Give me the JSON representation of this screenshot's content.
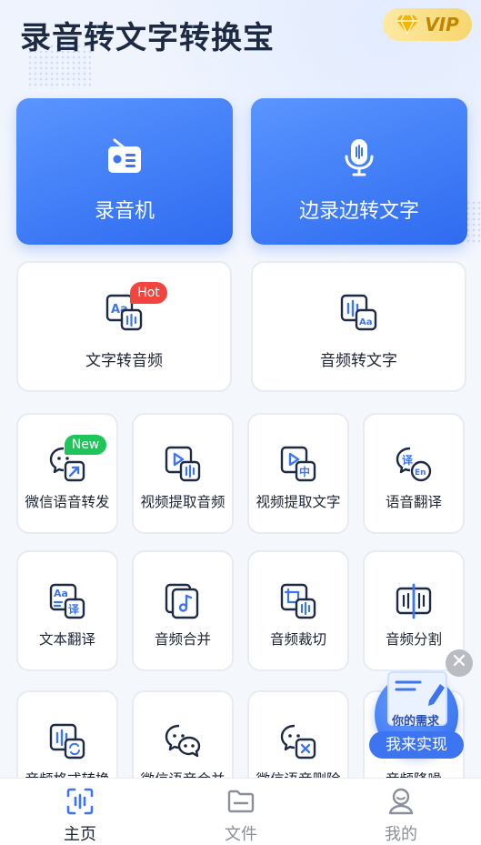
{
  "header": {
    "title": "录音转文字转换宝",
    "vip_label": "VIP"
  },
  "big_features": [
    {
      "label": "录音机",
      "icon": "radio-recorder-icon"
    },
    {
      "label": "边录边转文字",
      "icon": "microphone-icon"
    }
  ],
  "mid_features": [
    {
      "label": "文字转音频",
      "icon": "text-to-audio-icon",
      "badge": "Hot"
    },
    {
      "label": "音频转文字",
      "icon": "audio-to-text-icon"
    }
  ],
  "tools": [
    {
      "label": "微信语音转发",
      "icon": "wechat-forward-icon",
      "badge": "New"
    },
    {
      "label": "视频提取音频",
      "icon": "video-extract-audio-icon"
    },
    {
      "label": "视频提取文字",
      "icon": "video-extract-text-icon"
    },
    {
      "label": "语音翻译",
      "icon": "voice-translate-icon"
    },
    {
      "label": "文本翻译",
      "icon": "text-translate-icon"
    },
    {
      "label": "音频合并",
      "icon": "audio-merge-icon"
    },
    {
      "label": "音频裁切",
      "icon": "audio-crop-icon"
    },
    {
      "label": "音频分割",
      "icon": "audio-split-icon"
    },
    {
      "label": "音频格式转换",
      "icon": "audio-format-icon"
    },
    {
      "label": "微信语音合并",
      "icon": "wechat-merge-icon"
    },
    {
      "label": "微信语音删除",
      "icon": "wechat-delete-icon"
    },
    {
      "label": "音频降噪",
      "icon": "audio-denoise-icon"
    }
  ],
  "floating": {
    "need_text": "你的需求",
    "button_label": "我来实现",
    "close": "✕"
  },
  "tabbar": [
    {
      "label": "主页",
      "icon": "home-scan-icon",
      "active": true
    },
    {
      "label": "文件",
      "icon": "folder-icon",
      "active": false
    },
    {
      "label": "我的",
      "icon": "profile-icon",
      "active": false
    }
  ],
  "colors": {
    "primary": "#3c74f2",
    "hot": "#f2453d",
    "new": "#1ec65a",
    "vip_text": "#c28500"
  }
}
